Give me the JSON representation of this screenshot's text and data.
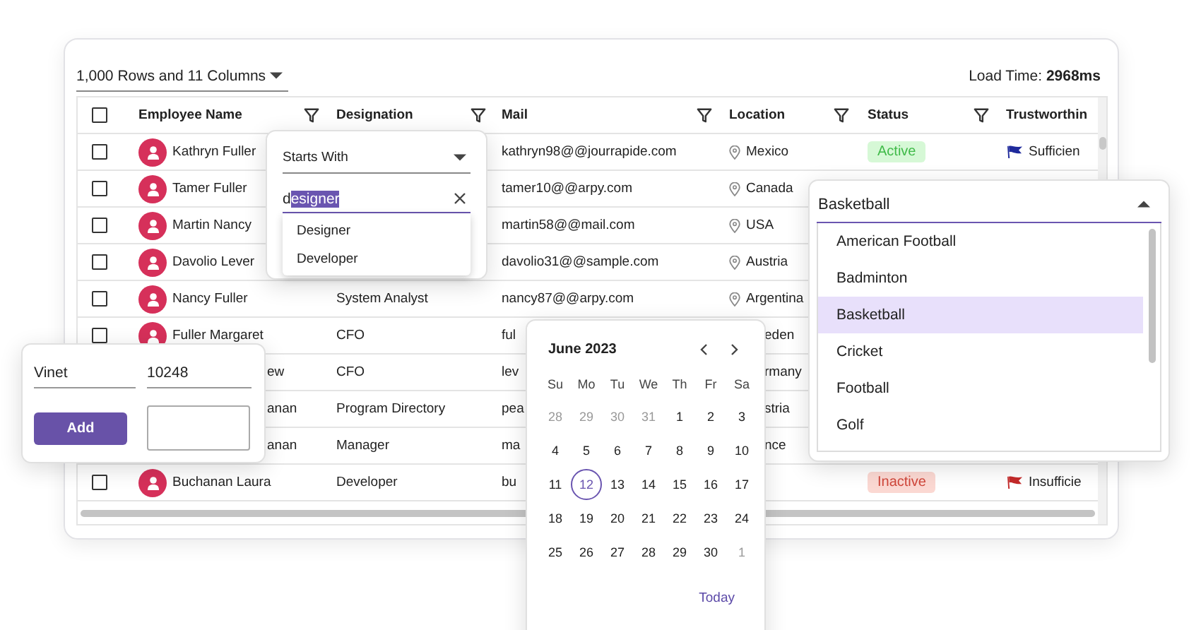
{
  "toolbar": {
    "rows_select": "1,000 Rows and 11 Columns",
    "load_time": "Load Time: **2968ms**"
  },
  "grid": {
    "header_checked": false,
    "columns": [
      {
        "label": "Employee Name",
        "filter": true
      },
      {
        "label": "Designation",
        "filter": true
      },
      {
        "label": "Mail",
        "filter": true
      },
      {
        "label": "Location",
        "filter": true
      },
      {
        "label": "Status",
        "filter": true
      },
      {
        "label": "Trustworthin",
        "filter": false
      }
    ],
    "rows": [
      {
        "checked": false,
        "name": {
          "text": "Kathryn Fuller",
          "kind": "full"
        },
        "mail": "kathryn98@@jourrapide.com",
        "location": {
          "text": "Mexico",
          "kind": "full"
        },
        "status": {
          "text": "Active",
          "kind": "active"
        },
        "trust": {
          "text": "Sufficien",
          "color": "#1f2a9c"
        }
      },
      {
        "checked": false,
        "name": {
          "text": "Tamer Fuller",
          "kind": "full"
        },
        "mail": "tamer10@@arpy.com",
        "location": {
          "text": "Canada",
          "kind": "full"
        }
      },
      {
        "checked": false,
        "name": {
          "text": "Martin Nancy",
          "kind": "full"
        },
        "mail": "martin58@@mail.com",
        "location": {
          "text": "USA",
          "kind": "full"
        }
      },
      {
        "checked": false,
        "name": {
          "text": "Davolio Lever",
          "kind": "full"
        },
        "mail": "davolio31@@sample.com",
        "location": {
          "text": "Austria",
          "kind": "full"
        }
      },
      {
        "checked": false,
        "name": {
          "text": "Nancy Fuller",
          "kind": "full"
        },
        "designation": "System Analyst",
        "mail": "nancy87@@arpy.com",
        "location": {
          "text": "Argentina",
          "kind": "full"
        }
      },
      {
        "checked": false,
        "name": {
          "text": "Fuller Margaret",
          "kind": "full"
        },
        "designation": "CFO",
        "mail": "ful",
        "location": {
          "text": "eden",
          "kind": "tail"
        }
      },
      {
        "name": {
          "text": "ew",
          "kind": "tail"
        },
        "designation": "CFO",
        "mail": "lev",
        "location": {
          "text": "rmany",
          "kind": "tail"
        }
      },
      {
        "name": {
          "text": "anan",
          "kind": "tail"
        },
        "designation": "Program Directory",
        "mail": "pea",
        "location": {
          "text": "stria",
          "kind": "tail"
        }
      },
      {
        "name": {
          "text": "anan",
          "kind": "tail"
        },
        "designation": "Manager",
        "mail": "ma",
        "location": {
          "text": "nce",
          "kind": "tail"
        }
      },
      {
        "checked": false,
        "name": {
          "text": "Buchanan Laura",
          "kind": "full"
        },
        "designation": "Developer",
        "mail": "bu",
        "status": {
          "text": "Inactive",
          "kind": "inactive"
        },
        "trust": {
          "text": "Insufficie",
          "color": "#c42a2a"
        }
      }
    ]
  },
  "filter_popup": {
    "operator": "Starts With",
    "value_typed": "d",
    "value_selected": "esigner",
    "suggestions": [
      "Designer",
      "Developer"
    ]
  },
  "edit_popup": {
    "fields": [
      "Vinet",
      "10248"
    ],
    "button": "Add"
  },
  "calendar": {
    "title": "June 2023",
    "weekdays": [
      "Su",
      "Mo",
      "Tu",
      "We",
      "Th",
      "Fr",
      "Sa"
    ],
    "today": "Today",
    "weeks": [
      [
        {
          "label": "28",
          "muted": true,
          "selected": false
        },
        {
          "label": "29",
          "muted": true,
          "selected": false
        },
        {
          "label": "30",
          "muted": true,
          "selected": false
        },
        {
          "label": "31",
          "muted": true,
          "selected": false
        },
        {
          "label": "1",
          "muted": false,
          "selected": false
        },
        {
          "label": "2",
          "muted": false,
          "selected": false
        },
        {
          "label": "3",
          "muted": false,
          "selected": false
        }
      ],
      [
        {
          "label": "4",
          "muted": false,
          "selected": false
        },
        {
          "label": "5",
          "muted": false,
          "selected": false
        },
        {
          "label": "6",
          "muted": false,
          "selected": false
        },
        {
          "label": "7",
          "muted": false,
          "selected": false
        },
        {
          "label": "8",
          "muted": false,
          "selected": false
        },
        {
          "label": "9",
          "muted": false,
          "selected": false
        },
        {
          "label": "10",
          "muted": false,
          "selected": false
        }
      ],
      [
        {
          "label": "11",
          "muted": false,
          "selected": false
        },
        {
          "label": "12",
          "muted": false,
          "selected": true
        },
        {
          "label": "13",
          "muted": false,
          "selected": false
        },
        {
          "label": "14",
          "muted": false,
          "selected": false
        },
        {
          "label": "15",
          "muted": false,
          "selected": false
        },
        {
          "label": "16",
          "muted": false,
          "selected": false
        },
        {
          "label": "17",
          "muted": false,
          "selected": false
        }
      ],
      [
        {
          "label": "18",
          "muted": false,
          "selected": false
        },
        {
          "label": "19",
          "muted": false,
          "selected": false
        },
        {
          "label": "20",
          "muted": false,
          "selected": false
        },
        {
          "label": "21",
          "muted": false,
          "selected": false
        },
        {
          "label": "22",
          "muted": false,
          "selected": false
        },
        {
          "label": "23",
          "muted": false,
          "selected": false
        },
        {
          "label": "24",
          "muted": false,
          "selected": false
        }
      ],
      [
        {
          "label": "25",
          "muted": false,
          "selected": false
        },
        {
          "label": "26",
          "muted": false,
          "selected": false
        },
        {
          "label": "27",
          "muted": false,
          "selected": false
        },
        {
          "label": "28",
          "muted": false,
          "selected": false
        },
        {
          "label": "29",
          "muted": false,
          "selected": false
        },
        {
          "label": "30",
          "muted": false,
          "selected": false
        },
        {
          "label": "1",
          "muted": true,
          "selected": false
        }
      ]
    ]
  },
  "sport_dropdown": {
    "value": "Basketball",
    "options": [
      {
        "label": "American Football",
        "selected": false
      },
      {
        "label": "Badminton",
        "selected": false
      },
      {
        "label": "Basketball",
        "selected": true
      },
      {
        "label": "Cricket",
        "selected": false
      },
      {
        "label": "Football",
        "selected": false
      },
      {
        "label": "Golf",
        "selected": false
      }
    ]
  }
}
